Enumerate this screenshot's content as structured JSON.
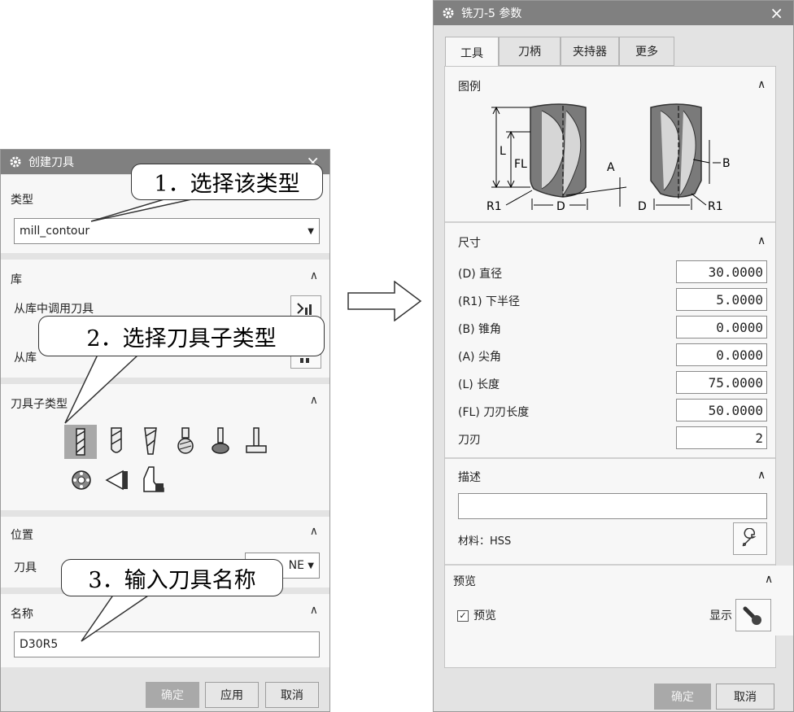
{
  "left_dialog": {
    "title": "创建刀具",
    "type_section": {
      "title": "类型",
      "value": "mill_contour"
    },
    "library_section": {
      "title": "库",
      "retrieve_label": "从库中调用刀具",
      "export_label": "从库"
    },
    "subtype_section": {
      "title": "刀具子类型"
    },
    "location_section": {
      "title": "位置",
      "tool_label": "刀具",
      "tool_value": "NE"
    },
    "name_section": {
      "title": "名称",
      "value": "D30R5"
    },
    "buttons": {
      "ok": "确定",
      "apply": "应用",
      "cancel": "取消"
    }
  },
  "callouts": {
    "c1": "1．选择该类型",
    "c2": "2．选择刀具子类型",
    "c3": "3．输入刀具名称"
  },
  "right_dialog": {
    "title": "铣刀-5 参数",
    "tabs": [
      "工具",
      "刀柄",
      "夹持器",
      "更多"
    ],
    "legend_section": {
      "title": "图例",
      "labels": {
        "L": "L",
        "FL": "FL",
        "R1_left": "R1",
        "D_left": "D",
        "A": "A",
        "B": "B",
        "D_right": "D",
        "R1_right": "R1"
      }
    },
    "size_section": {
      "title": "尺寸",
      "rows": [
        {
          "label": "(D) 直径",
          "value": "30.0000"
        },
        {
          "label": "(R1) 下半径",
          "value": "5.0000"
        },
        {
          "label": "(B) 锥角",
          "value": "0.0000"
        },
        {
          "label": "(A) 尖角",
          "value": "0.0000"
        },
        {
          "label": "(L) 长度",
          "value": "75.0000"
        },
        {
          "label": "(FL) 刀刃长度",
          "value": "50.0000"
        },
        {
          "label": "刀刃",
          "value": "2"
        }
      ]
    },
    "desc_section": {
      "title": "描述",
      "value": "",
      "material": "材料：HSS"
    },
    "preview_section": {
      "title": "预览",
      "checkbox_label": "预览",
      "show_label": "显示"
    },
    "buttons": {
      "ok": "确定",
      "cancel": "取消"
    }
  },
  "icons": [
    "gear-icon",
    "close-icon",
    "dropdown-arrow-icon",
    "collapse-caret-icon",
    "library-retrieve-icon",
    "library-export-icon",
    "wrench-icon",
    "show-tool-icon",
    "checkbox-checked-icon",
    "right-arrow-icon"
  ]
}
